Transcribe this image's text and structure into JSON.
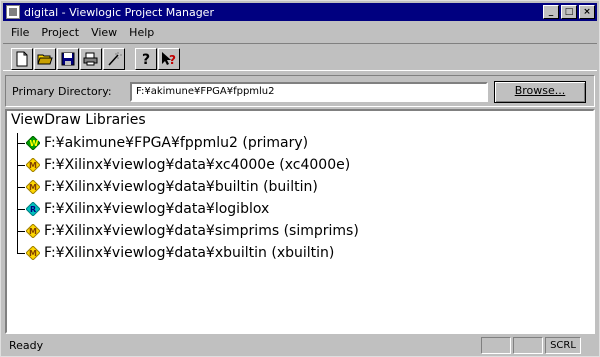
{
  "window": {
    "title": "digital - Viewlogic Project Manager",
    "controls": {
      "minimize": "_",
      "maximize": "□",
      "close": "×"
    }
  },
  "menu": [
    "File",
    "Project",
    "View",
    "Help"
  ],
  "toolbar": {
    "buttons": [
      "new-file-icon",
      "open-folder-icon",
      "save-icon",
      "print-icon",
      "wand-icon",
      "help-icon",
      "context-help-icon"
    ]
  },
  "primary": {
    "label": "Primary Directory:",
    "value": "F:¥akimune¥FPGA¥fppmlu2",
    "browse_label": "Browse..."
  },
  "libraries": {
    "heading": "ViewDraw Libraries",
    "items": [
      {
        "label": "F:¥akimune¥FPGA¥fppmlu2 (primary)",
        "icon": "primary-library-icon",
        "color": "#00a000",
        "letter": "W"
      },
      {
        "label": "F:¥Xilinx¥viewlog¥data¥xc4000e (xc4000e)",
        "icon": "library-icon",
        "color": "#ffd700",
        "letter": "M"
      },
      {
        "label": "F:¥Xilinx¥viewlog¥data¥builtin (builtin)",
        "icon": "library-icon",
        "color": "#ffd700",
        "letter": "M"
      },
      {
        "label": "F:¥Xilinx¥viewlog¥data¥logiblox",
        "icon": "local-library-icon",
        "color": "#00c0c0",
        "letter": "R"
      },
      {
        "label": "F:¥Xilinx¥viewlog¥data¥simprims (simprims)",
        "icon": "library-icon",
        "color": "#ffd700",
        "letter": "M"
      },
      {
        "label": "F:¥Xilinx¥viewlog¥data¥xbuiltin (xbuiltin)",
        "icon": "library-icon",
        "color": "#ffd700",
        "letter": "M"
      }
    ]
  },
  "status": {
    "text": "Ready",
    "scrl": "SCRL"
  }
}
